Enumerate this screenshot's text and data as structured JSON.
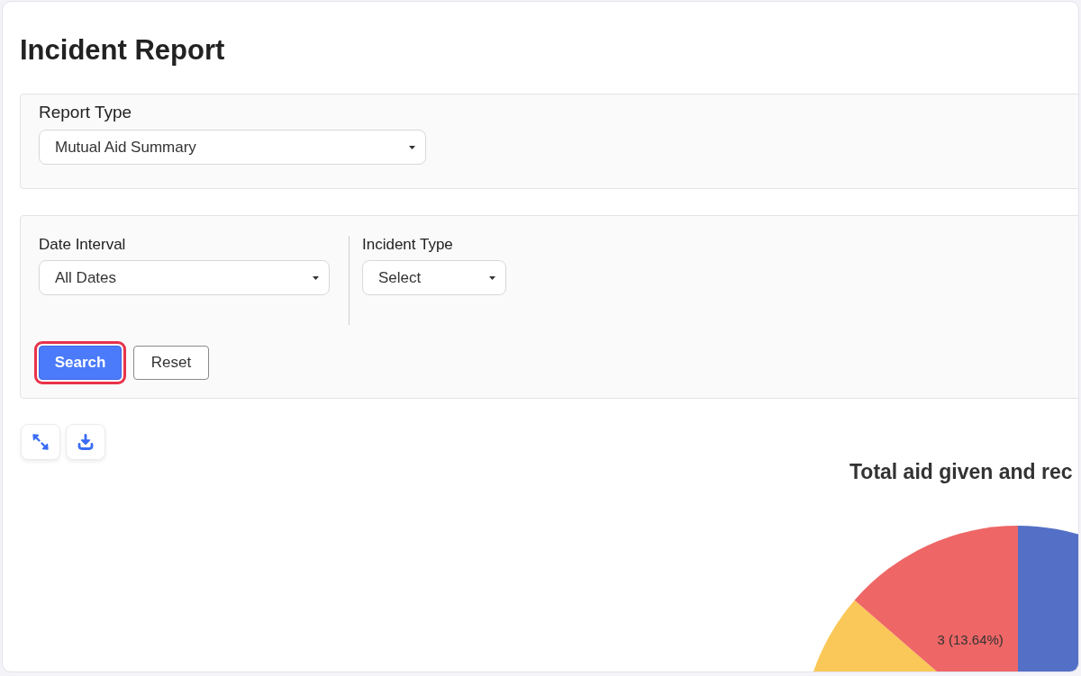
{
  "page": {
    "title": "Incident Report",
    "report_type": {
      "label": "Report Type",
      "value": "Mutual Aid Summary"
    },
    "filters": [
      {
        "label": "Date Interval",
        "value": "All Dates"
      },
      {
        "label": "Incident Type",
        "value": "Select"
      }
    ],
    "buttons": [
      {
        "label": "Search",
        "kind": "primary",
        "highlighted": true
      },
      {
        "label": "Reset",
        "kind": "secondary",
        "highlighted": false
      }
    ],
    "chart": {
      "chart_data": {
        "type": "pie",
        "title": "Total aid given and rec",
        "values": [
          15,
          4,
          3
        ],
        "colors": [
          "#5470c6",
          "#fac858",
          "#ee6666"
        ],
        "value_labels": [
          null,
          null,
          "3 (13.64%)"
        ]
      }
    }
  }
}
